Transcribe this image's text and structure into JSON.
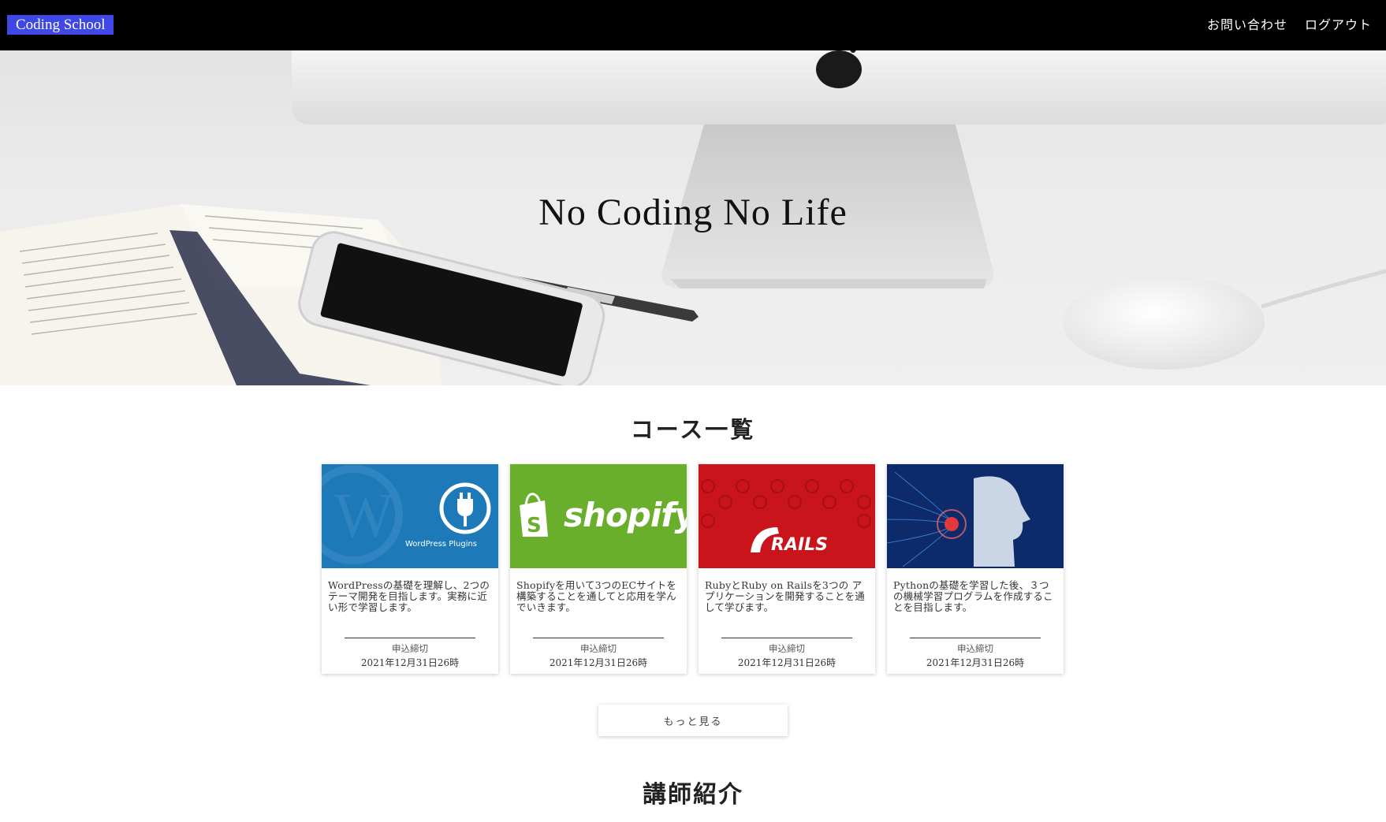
{
  "header": {
    "logo": "Coding School",
    "nav": [
      "お問い合わせ",
      "ログアウト"
    ]
  },
  "hero": {
    "title": "No Coding No Life"
  },
  "courses": {
    "title": "コース一覧",
    "deadline_label": "申込締切",
    "items": [
      {
        "image_icon": "wordpress-plugins-image",
        "image_text": "WordPress Plugins",
        "description": "WordPressの基礎を理解し、2つのテーマ開発を目指します。実務に近い形で学習します。",
        "deadline": "2021年12月31日26時"
      },
      {
        "image_icon": "shopify-logo-image",
        "image_text": "shopify",
        "description": "Shopifyを用いて3つのECサイトを構築することを通してと応用を学んでいきます。",
        "deadline": "2021年12月31日26時"
      },
      {
        "image_icon": "rails-logo-image",
        "image_text": "RAILS",
        "description": "RubyとRuby on Railsを3つの アプリケーションを開発することを通して学びます。",
        "deadline": "2021年12月31日26時"
      },
      {
        "image_icon": "ai-head-image",
        "image_text": "",
        "description": "Pythonの基礎を学習した後、３つの機械学習プログラムを作成することを目指します。",
        "deadline": "2021年12月31日26時"
      }
    ],
    "more_label": "もっと見る"
  },
  "teachers": {
    "title": "講師紹介"
  },
  "colors": {
    "header_bg": "#000000",
    "logo_bg": "#3f48e6",
    "wordpress": "#1e79b8",
    "shopify": "#6aaf2c",
    "rails": "#c8141a",
    "python": "#0d2a6b"
  }
}
